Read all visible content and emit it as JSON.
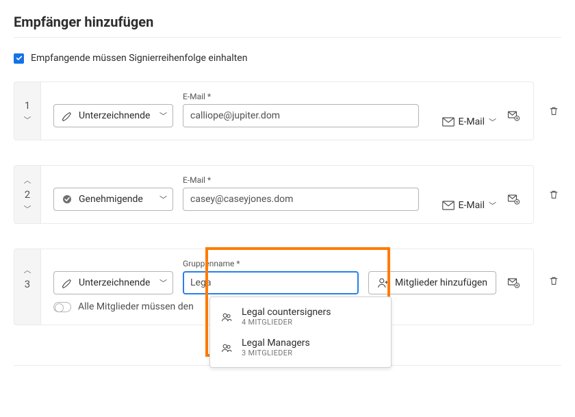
{
  "title": "Empfänger hinzufügen",
  "orderCheckbox": {
    "checked": true,
    "label": "Empfangende müssen Signierreihenfolge einhalten"
  },
  "labels": {
    "email": "E-Mail",
    "groupName": "Gruppenname",
    "delivery": "E-Mail",
    "addMembers": "Mitglieder hinzufügen",
    "allMembersPrefix": "Alle Mitglieder müssen den "
  },
  "roles": {
    "signer": "Unterzeichnende",
    "approver": "Genehmigende"
  },
  "recipients": [
    {
      "num": "1",
      "role": "signer",
      "email": "calliope@jupiter.dom"
    },
    {
      "num": "2",
      "role": "approver",
      "email": "casey@caseyjones.dom"
    }
  ],
  "group": {
    "num": "3",
    "role": "signer",
    "nameInput": "Lega",
    "suggestions": [
      {
        "name": "Legal countersigners",
        "members": "4 MITGLIEDER"
      },
      {
        "name": "Legal Managers",
        "members": "3 MITGLIEDER"
      }
    ]
  }
}
